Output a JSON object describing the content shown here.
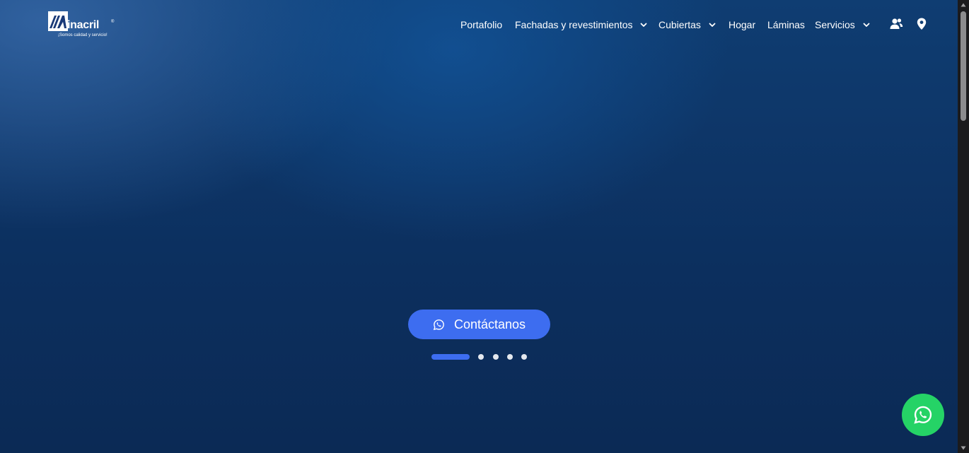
{
  "logo": {
    "wordmark": "inacril",
    "registered": "®",
    "tagline": "¡Somos calidad y servicio!"
  },
  "nav": {
    "items": [
      {
        "label": "Portafolio",
        "has_dropdown": false
      },
      {
        "label": "Fachadas y revestimientos",
        "has_dropdown": true
      },
      {
        "label": "Cubiertas",
        "has_dropdown": true
      },
      {
        "label": "Hogar",
        "has_dropdown": false
      },
      {
        "label": "Láminas",
        "has_dropdown": false
      },
      {
        "label": "Servicios",
        "has_dropdown": true
      }
    ],
    "icons": [
      "users-icon",
      "location-pin-icon"
    ]
  },
  "hero": {
    "cta_label": "Contáctanos",
    "cta_icon": "whatsapp-icon",
    "slides_total": 5,
    "active_slide": 1
  },
  "floating_button": {
    "icon": "whatsapp-icon"
  },
  "colors": {
    "background": "#0c2f5e",
    "accent": "#3d6df0",
    "whatsapp": "#25d366",
    "text": "#ffffff"
  }
}
